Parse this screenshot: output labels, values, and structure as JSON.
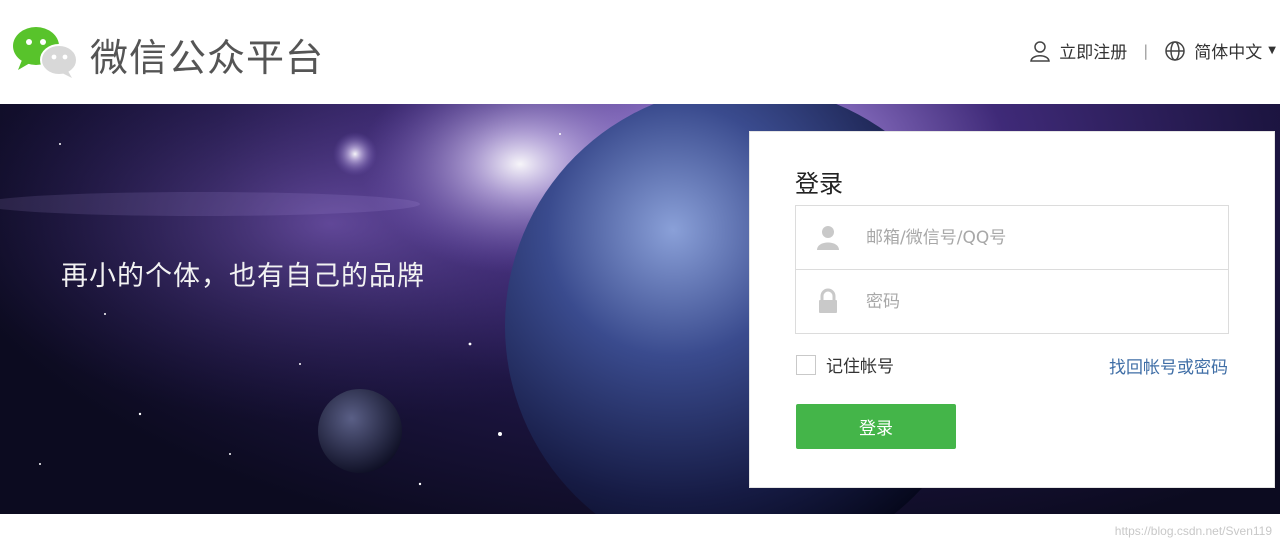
{
  "header": {
    "brand": "微信公众平台",
    "register_label": "立即注册",
    "separator": "|",
    "language_label": "简体中文"
  },
  "banner": {
    "slogan": "再小的个体，也有自己的品牌"
  },
  "login": {
    "title": "登录",
    "account_placeholder": "邮箱/微信号/QQ号",
    "account_value": "",
    "password_placeholder": "密码",
    "password_value": "",
    "remember_label": "记住帐号",
    "forgot_label": "找回帐号或密码",
    "submit_label": "登录"
  },
  "watermark": "https://blog.csdn.net/Sven119",
  "icons": {
    "logo": "wechat-logo",
    "register": "user-icon",
    "language": "globe-icon",
    "account": "person-icon",
    "password": "lock-icon"
  },
  "colors": {
    "primary_button": "#44b549",
    "link": "#3f6ea6",
    "brand_text": "#555555"
  }
}
